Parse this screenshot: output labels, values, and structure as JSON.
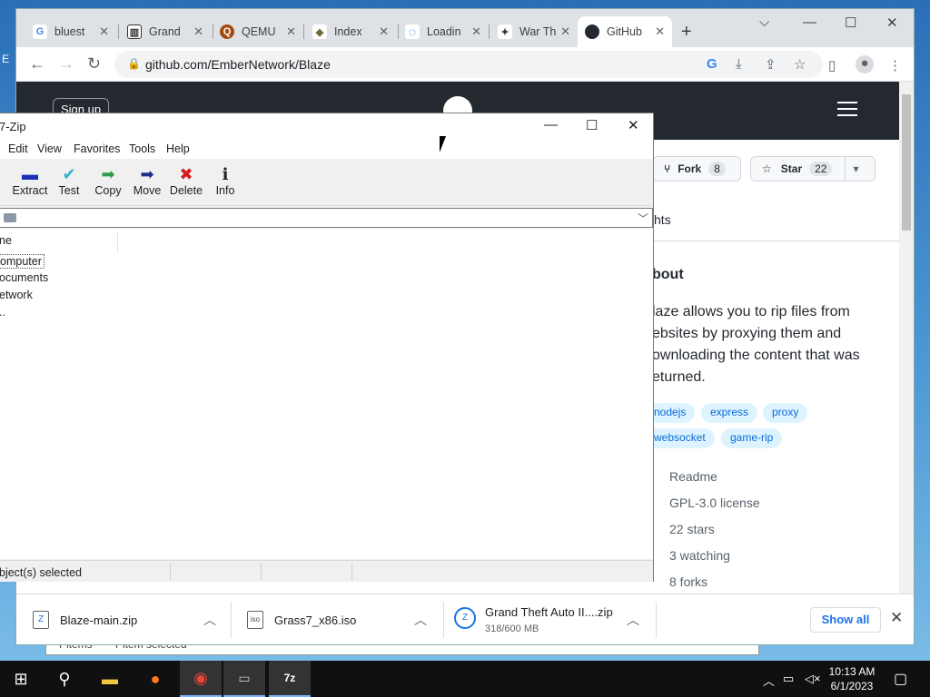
{
  "desktop": {
    "letters": [
      "E"
    ]
  },
  "browser": {
    "tabs": [
      {
        "title": "bluest",
        "favicon": "G",
        "color": "#ffffff",
        "fg": "#4285f4"
      },
      {
        "title": "Grand",
        "favicon": "🏛",
        "color": "#ffffff",
        "fg": "#333333"
      },
      {
        "title": "QEMU",
        "favicon": "Q",
        "color": "#a24b10",
        "fg": "#ffffff"
      },
      {
        "title": "Index",
        "favicon": "◆",
        "color": "#ffffff",
        "fg": "#6b6b3a"
      },
      {
        "title": "Loadin",
        "favicon": "◌",
        "color": "#ffffff",
        "fg": "#1a73e8"
      },
      {
        "title": "War Th",
        "favicon": "✦",
        "color": "#ffffff",
        "fg": "#333333"
      },
      {
        "title": "GitHub",
        "favicon": "●",
        "color": "#ffffff",
        "fg": "#24292f"
      }
    ],
    "url": "github.com/EmberNetwork/Blaze"
  },
  "github": {
    "signup": "Sign up",
    "fork_label": "Fork",
    "fork_count": "8",
    "star_label": "Star",
    "star_count": "22",
    "insights_partial": "hts",
    "about_heading": "bout",
    "description": [
      "laze allows you to rip files from",
      "ebsites by proxying them and",
      "ownloading the content that was",
      "eturned."
    ],
    "topics": [
      "nodejs",
      "express",
      "proxy",
      "websocket",
      "game-rip"
    ],
    "meta": [
      "Readme",
      "GPL-3.0 license",
      "22 stars",
      "3 watching",
      "8 forks"
    ]
  },
  "downloads": {
    "items": [
      {
        "name": "Blaze-main.zip",
        "sub": ""
      },
      {
        "name": "Grass7_x86.iso",
        "sub": ""
      },
      {
        "name": "Grand Theft Auto II....zip",
        "sub": "318/600 MB"
      }
    ],
    "show_all": "Show all"
  },
  "sevenzip": {
    "title": "7-Zip",
    "menu": [
      "Edit",
      "View",
      "Favorites",
      "Tools",
      "Help"
    ],
    "tools": [
      {
        "label": "Extract",
        "icon": "minus-icon",
        "glyph": "▬",
        "color": "#1b2fb8"
      },
      {
        "label": "Test",
        "icon": "check-icon",
        "glyph": "✔",
        "color": "#2ab6c6"
      },
      {
        "label": "Copy",
        "icon": "arrow-right-icon",
        "glyph": "➡",
        "color": "#2e9c4a"
      },
      {
        "label": "Move",
        "icon": "arrow-right-icon",
        "glyph": "➡",
        "color": "#1c2d8a"
      },
      {
        "label": "Delete",
        "icon": "delete-icon",
        "glyph": "✖",
        "color": "#d61c1c"
      },
      {
        "label": "Info",
        "icon": "info-icon",
        "glyph": "ℹ",
        "color": "#222222"
      }
    ],
    "column_header": "ne",
    "rows": [
      "omputer",
      "ocuments",
      "etwork",
      ".."
    ],
    "status": "bject(s) selected"
  },
  "background_app": {
    "status_left": "Pitems",
    "status_right": "Pitem selected"
  },
  "taskbar": {
    "time": "10:13 AM",
    "date": "6/1/2023"
  }
}
